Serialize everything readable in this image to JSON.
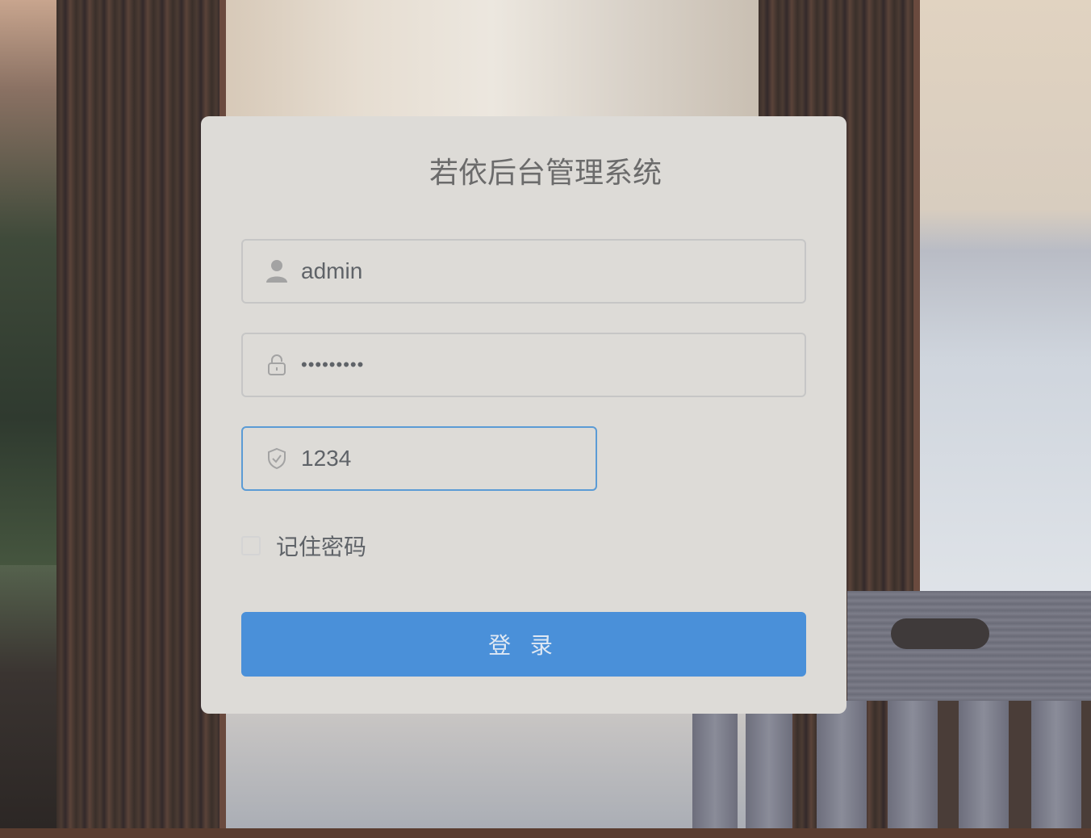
{
  "title": "若依后台管理系统",
  "username": {
    "value": "admin",
    "icon": "user-icon"
  },
  "password": {
    "value": "•••••••••",
    "icon": "lock-icon"
  },
  "captcha": {
    "value": "1234",
    "icon": "shield-check-icon"
  },
  "remember": {
    "label": "记住密码",
    "checked": false
  },
  "login_button": {
    "label": "登 录"
  },
  "colors": {
    "accent": "#4a90d9",
    "card": "#dddbd7",
    "text": "#5f6368"
  }
}
